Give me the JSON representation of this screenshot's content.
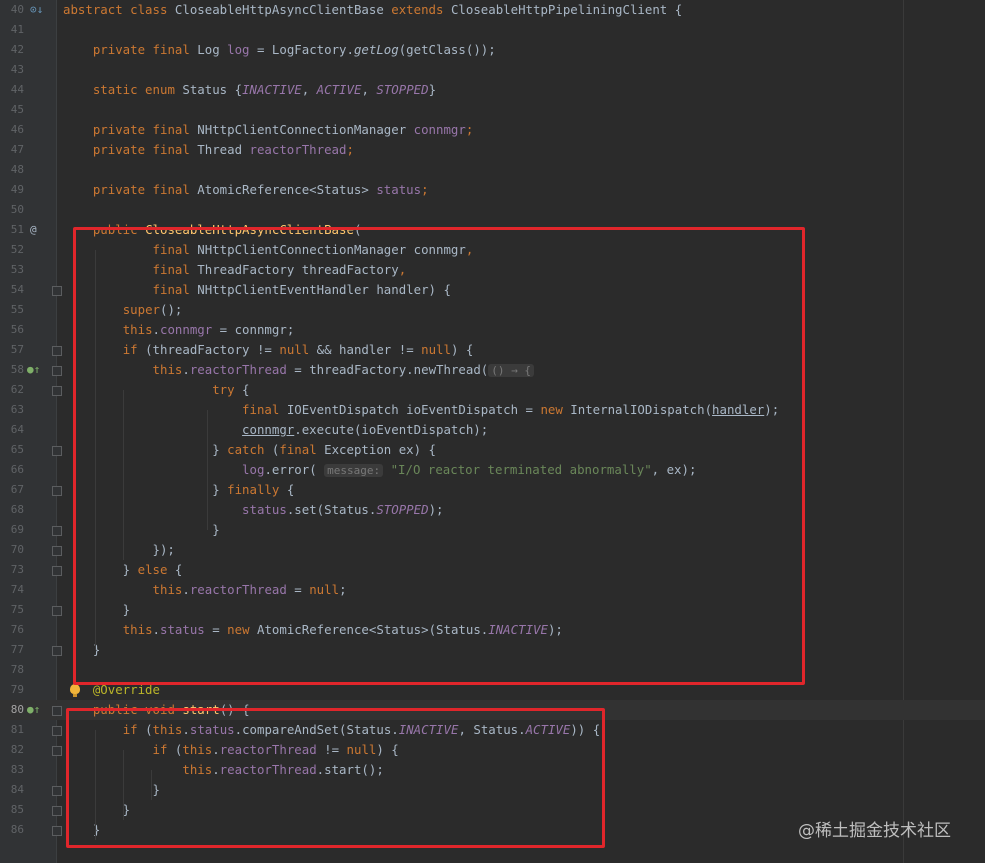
{
  "editor": {
    "lines": [
      {
        "n": "40",
        "icon": "override",
        "tokens": [
          [
            "kw",
            "abstract class "
          ],
          [
            "",
            "CloseableHttpAsyncClientBase "
          ],
          [
            "kw",
            "extends "
          ],
          [
            "",
            "CloseableHttpPipeliningClient {"
          ]
        ]
      },
      {
        "n": "41",
        "tokens": []
      },
      {
        "n": "42",
        "tokens": [
          [
            "",
            "    "
          ],
          [
            "kw",
            "private final "
          ],
          [
            "",
            "Log "
          ],
          [
            "fld",
            "log"
          ],
          [
            "",
            " = LogFactory."
          ],
          [
            "sm",
            "getLog"
          ],
          [
            "",
            "(getClass());"
          ]
        ]
      },
      {
        "n": "43",
        "tokens": []
      },
      {
        "n": "44",
        "tokens": [
          [
            "",
            "    "
          ],
          [
            "kw",
            "static enum "
          ],
          [
            "",
            "Status {"
          ],
          [
            "cst",
            "INACTIVE"
          ],
          [
            "",
            ", "
          ],
          [
            "cst",
            "ACTIVE"
          ],
          [
            "",
            ", "
          ],
          [
            "cst",
            "STOPPED"
          ],
          [
            "",
            "}"
          ]
        ]
      },
      {
        "n": "45",
        "tokens": []
      },
      {
        "n": "46",
        "tokens": [
          [
            "",
            "    "
          ],
          [
            "kw",
            "private final "
          ],
          [
            "",
            "NHttpClientConnectionManager "
          ],
          [
            "fld",
            "connmgr"
          ],
          [
            "kw",
            ";"
          ]
        ]
      },
      {
        "n": "47",
        "tokens": [
          [
            "",
            "    "
          ],
          [
            "kw",
            "private final "
          ],
          [
            "",
            "Thread "
          ],
          [
            "fld",
            "reactorThread"
          ],
          [
            "kw",
            ";"
          ]
        ]
      },
      {
        "n": "48",
        "tokens": []
      },
      {
        "n": "49",
        "tokens": [
          [
            "",
            "    "
          ],
          [
            "kw",
            "private final "
          ],
          [
            "",
            "AtomicReference<Status> "
          ],
          [
            "fld",
            "status"
          ],
          [
            "kw",
            ";"
          ]
        ]
      },
      {
        "n": "50",
        "tokens": []
      },
      {
        "n": "51",
        "icon": "at",
        "tokens": [
          [
            "",
            "    "
          ],
          [
            "kw",
            "public "
          ],
          [
            "fn",
            "CloseableHttpAsyncClientBase"
          ],
          [
            "",
            "("
          ]
        ]
      },
      {
        "n": "52",
        "tokens": [
          [
            "",
            "            "
          ],
          [
            "kw",
            "final "
          ],
          [
            "",
            "NHttpClientConnectionManager connmgr"
          ],
          [
            "kw",
            ","
          ]
        ]
      },
      {
        "n": "53",
        "tokens": [
          [
            "",
            "            "
          ],
          [
            "kw",
            "final "
          ],
          [
            "",
            "ThreadFactory threadFactory"
          ],
          [
            "kw",
            ","
          ]
        ]
      },
      {
        "n": "54",
        "fold": true,
        "tokens": [
          [
            "",
            "            "
          ],
          [
            "kw",
            "final "
          ],
          [
            "",
            "NHttpClientEventHandler handler) {"
          ]
        ]
      },
      {
        "n": "55",
        "tokens": [
          [
            "",
            "        "
          ],
          [
            "kw",
            "super"
          ],
          [
            "",
            "();"
          ]
        ]
      },
      {
        "n": "56",
        "tokens": [
          [
            "",
            "        "
          ],
          [
            "kw",
            "this"
          ],
          [
            "",
            "."
          ],
          [
            "fld",
            "connmgr"
          ],
          [
            "",
            " = connmgr;"
          ]
        ]
      },
      {
        "n": "57",
        "fold": true,
        "tokens": [
          [
            "",
            "        "
          ],
          [
            "kw",
            "if "
          ],
          [
            "",
            "(threadFactory != "
          ],
          [
            "kw",
            "null "
          ],
          [
            "",
            "&& handler != "
          ],
          [
            "kw",
            "null"
          ],
          [
            "",
            ") {"
          ]
        ]
      },
      {
        "n": "58",
        "icon": "impl",
        "fold": true,
        "tokens": [
          [
            "",
            "            "
          ],
          [
            "kw",
            "this"
          ],
          [
            "",
            "."
          ],
          [
            "fld",
            "reactorThread"
          ],
          [
            "",
            " = threadFactory.newThread("
          ],
          [
            "hint",
            "() → {"
          ]
        ]
      },
      {
        "n": "62",
        "fold": true,
        "tokens": [
          [
            "",
            "                    "
          ],
          [
            "kw",
            "try "
          ],
          [
            "",
            "{"
          ]
        ]
      },
      {
        "n": "63",
        "tokens": [
          [
            "",
            "                        "
          ],
          [
            "kw",
            "final "
          ],
          [
            "",
            "IOEventDispatch ioEventDispatch = "
          ],
          [
            "kw",
            "new "
          ],
          [
            "",
            "InternalIODispatch("
          ],
          [
            "ul",
            "handler"
          ],
          [
            "",
            ");"
          ]
        ]
      },
      {
        "n": "64",
        "tokens": [
          [
            "",
            "                        "
          ],
          [
            "ul",
            "connmgr"
          ],
          [
            "",
            ".execute(ioEventDispatch);"
          ]
        ]
      },
      {
        "n": "65",
        "fold": true,
        "tokens": [
          [
            "",
            "                    } "
          ],
          [
            "kw",
            "catch "
          ],
          [
            "",
            "("
          ],
          [
            "kw",
            "final "
          ],
          [
            "",
            "Exception ex) {"
          ]
        ]
      },
      {
        "n": "66",
        "tokens": [
          [
            "",
            "                        "
          ],
          [
            "fld",
            "log"
          ],
          [
            "",
            ".error( "
          ],
          [
            "hint",
            "message:"
          ],
          [
            "str",
            " \"I/O reactor terminated abnormally\""
          ],
          [
            "",
            ", ex);"
          ]
        ]
      },
      {
        "n": "67",
        "fold": true,
        "tokens": [
          [
            "",
            "                    } "
          ],
          [
            "kw",
            "finally "
          ],
          [
            "",
            "{"
          ]
        ]
      },
      {
        "n": "68",
        "tokens": [
          [
            "",
            "                        "
          ],
          [
            "fld",
            "status"
          ],
          [
            "",
            ".set(Status."
          ],
          [
            "cst",
            "STOPPED"
          ],
          [
            "",
            ");"
          ]
        ]
      },
      {
        "n": "69",
        "fold": true,
        "tokens": [
          [
            "",
            "                    }"
          ]
        ]
      },
      {
        "n": "70",
        "fold": true,
        "tokens": [
          [
            "",
            "            });"
          ]
        ]
      },
      {
        "n": "73",
        "fold": true,
        "tokens": [
          [
            "",
            "        } "
          ],
          [
            "kw",
            "else "
          ],
          [
            "",
            "{"
          ]
        ]
      },
      {
        "n": "74",
        "tokens": [
          [
            "",
            "            "
          ],
          [
            "kw",
            "this"
          ],
          [
            "",
            "."
          ],
          [
            "fld",
            "reactorThread"
          ],
          [
            "",
            " = "
          ],
          [
            "kw",
            "null"
          ],
          [
            "",
            ";"
          ]
        ]
      },
      {
        "n": "75",
        "fold": true,
        "tokens": [
          [
            "",
            "        }"
          ]
        ]
      },
      {
        "n": "76",
        "tokens": [
          [
            "",
            "        "
          ],
          [
            "kw",
            "this"
          ],
          [
            "",
            "."
          ],
          [
            "fld",
            "status"
          ],
          [
            "",
            " = "
          ],
          [
            "kw",
            "new "
          ],
          [
            "",
            "AtomicReference<Status>(Status."
          ],
          [
            "cst",
            "INACTIVE"
          ],
          [
            "",
            ");"
          ]
        ]
      },
      {
        "n": "77",
        "fold": true,
        "tokens": [
          [
            "",
            "    }"
          ]
        ]
      },
      {
        "n": "78",
        "tokens": []
      },
      {
        "n": "79",
        "bulb": true,
        "tokens": [
          [
            "",
            "    "
          ],
          [
            "ann",
            "@Override"
          ]
        ]
      },
      {
        "n": "80",
        "icon": "impl",
        "fold": true,
        "current": true,
        "tokens": [
          [
            "",
            "    "
          ],
          [
            "kw",
            "public void "
          ],
          [
            "fn",
            "start"
          ],
          [
            "",
            "() {"
          ]
        ]
      },
      {
        "n": "81",
        "fold": true,
        "tokens": [
          [
            "",
            "        "
          ],
          [
            "kw",
            "if "
          ],
          [
            "",
            "("
          ],
          [
            "kw",
            "this"
          ],
          [
            "",
            "."
          ],
          [
            "fld",
            "status"
          ],
          [
            "",
            ".compareAndSet(Status."
          ],
          [
            "cst",
            "INACTIVE"
          ],
          [
            "",
            ", Status."
          ],
          [
            "cst",
            "ACTIVE"
          ],
          [
            "",
            ")) {"
          ]
        ]
      },
      {
        "n": "82",
        "fold": true,
        "tokens": [
          [
            "",
            "            "
          ],
          [
            "kw",
            "if "
          ],
          [
            "",
            "("
          ],
          [
            "kw",
            "this"
          ],
          [
            "",
            "."
          ],
          [
            "fld",
            "reactorThread"
          ],
          [
            "",
            " != "
          ],
          [
            "kw",
            "null"
          ],
          [
            "",
            ") {"
          ]
        ]
      },
      {
        "n": "83",
        "tokens": [
          [
            "",
            "                "
          ],
          [
            "kw",
            "this"
          ],
          [
            "",
            "."
          ],
          [
            "fld",
            "reactorThread"
          ],
          [
            "",
            ".start();"
          ]
        ]
      },
      {
        "n": "84",
        "fold": true,
        "tokens": [
          [
            "",
            "            }"
          ]
        ]
      },
      {
        "n": "85",
        "fold": true,
        "tokens": [
          [
            "",
            "        }"
          ]
        ]
      },
      {
        "n": "86",
        "fold": true,
        "tokens": [
          [
            "",
            "    }"
          ]
        ]
      }
    ]
  },
  "watermark": "@稀土掘金技术社区",
  "colors": {
    "highlight_box": "#e0262b",
    "background": "#2b2b2b"
  }
}
